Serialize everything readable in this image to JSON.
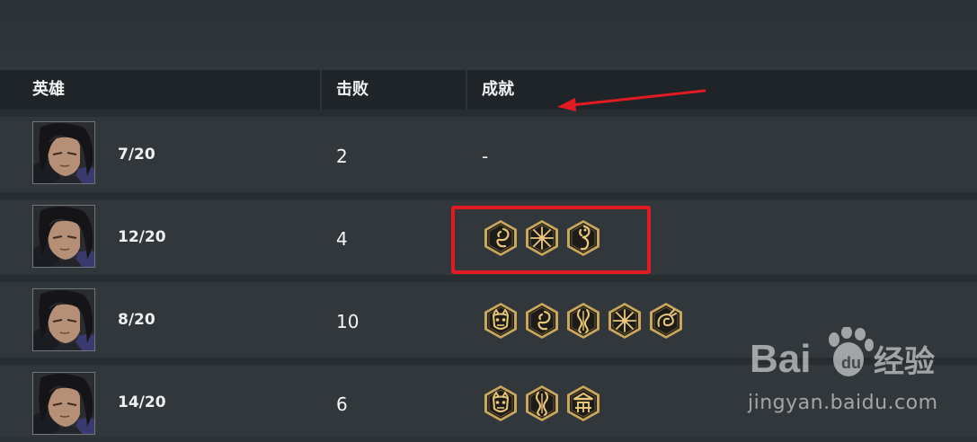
{
  "table": {
    "columns": {
      "hero": "英雄",
      "defeats": "击败",
      "achievements": "成就"
    },
    "rows": [
      {
        "level": "7/20",
        "defeats": "2",
        "achievements_text": "-",
        "badges": []
      },
      {
        "level": "12/20",
        "defeats": "4",
        "achievements_text": "",
        "badges": [
          "dragon-coil",
          "crossed-blades",
          "seahorse-dragon"
        ]
      },
      {
        "level": "8/20",
        "defeats": "10",
        "achievements_text": "",
        "badges": [
          "oni-mask",
          "dragon-coil",
          "twin-serpent",
          "crossed-blades",
          "coiled-dragon"
        ]
      },
      {
        "level": "14/20",
        "defeats": "6",
        "achievements_text": "",
        "badges": [
          "oni-mask",
          "twin-serpent",
          "pagoda-gate"
        ]
      }
    ]
  },
  "annotations": {
    "highlight_color": "#e21b22",
    "arrow_color": "#e21b22"
  },
  "watermark": {
    "brand": "Baidu经验",
    "url": "jingyan.baidu.com"
  }
}
